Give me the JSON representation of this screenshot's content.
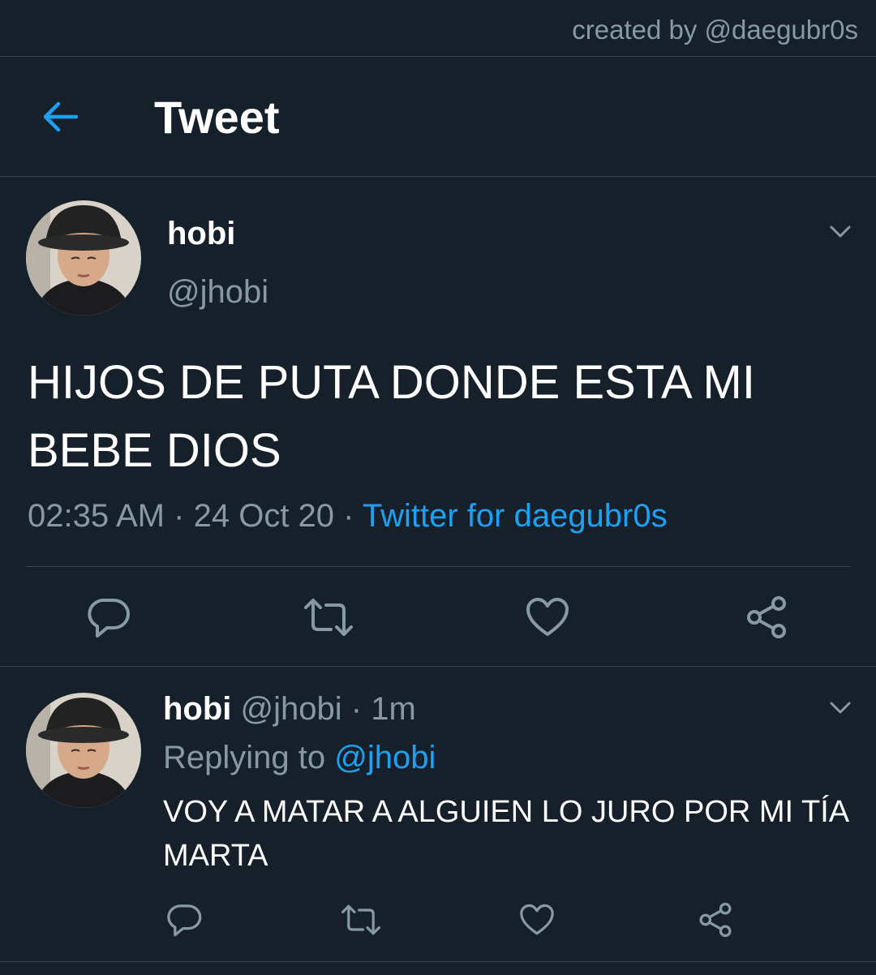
{
  "watermark": "created by @daegubr0s",
  "header": {
    "title": "Tweet",
    "back_icon": "arrow-left-icon"
  },
  "main_tweet": {
    "display_name": "hobi",
    "handle": "@jhobi",
    "text": "HIJOS DE PUTA DONDE ESTA MI BEBE DIOS",
    "time": "02:35 AM",
    "date": "24 Oct 20",
    "separator": "·",
    "source": "Twitter for daegubr0s",
    "menu_icon": "chevron-down-icon",
    "actions": [
      "reply-icon",
      "retweet-icon",
      "like-icon",
      "share-icon"
    ]
  },
  "reply_tweet": {
    "display_name": "hobi",
    "handle": "@jhobi",
    "separator": "·",
    "age": "1m",
    "replying_prefix": "Replying to",
    "replying_handle": "@jhobi",
    "text": "VOY A MATAR A ALGUIEN LO JURO POR MI TÍA MARTA",
    "menu_icon": "chevron-down-icon",
    "actions": [
      "reply-icon",
      "retweet-icon",
      "like-icon",
      "share-icon"
    ]
  },
  "colors": {
    "background": "#15202b",
    "divider": "#38444d",
    "muted": "#8899a6",
    "accent": "#1da1f2",
    "text": "#ffffff"
  }
}
